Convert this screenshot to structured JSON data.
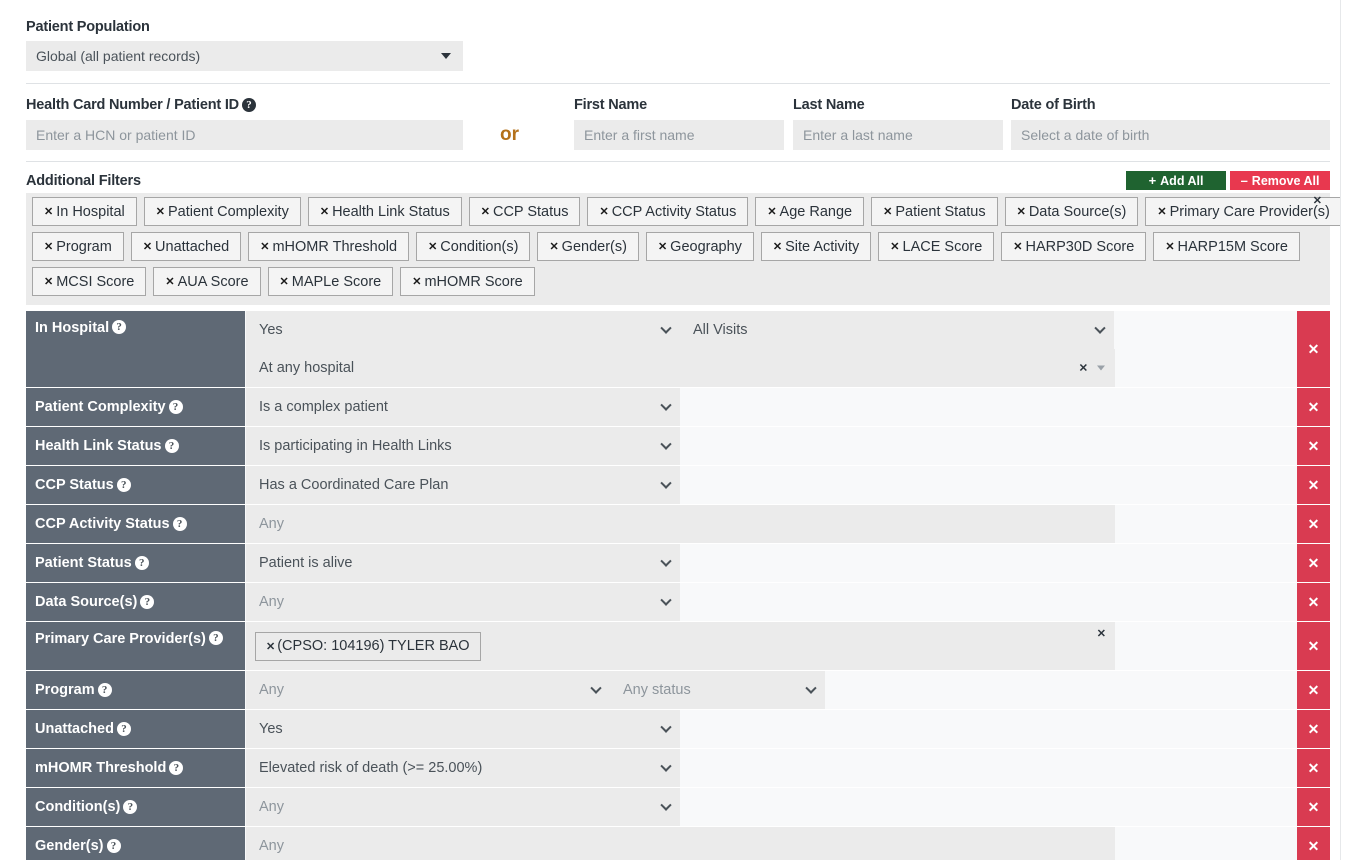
{
  "population": {
    "label": "Patient Population",
    "value": "Global (all patient records)"
  },
  "identity": {
    "hcn_label": "Health Card Number / Patient ID",
    "hcn_placeholder": "Enter a HCN or patient ID",
    "or_text": "or",
    "first_name_label": "First Name",
    "first_name_placeholder": "Enter a first name",
    "last_name_label": "Last Name",
    "last_name_placeholder": "Enter a last name",
    "dob_label": "Date of Birth",
    "dob_placeholder": "Select a date of birth"
  },
  "additional_filters": {
    "label": "Additional Filters",
    "add_all_label": "Add All",
    "remove_all_label": "Remove All",
    "add_all_sign": "+",
    "remove_all_sign": "–",
    "close_glyph": "✕",
    "tag_rows": [
      [
        "In Hospital",
        "Patient Complexity",
        "Health Link Status",
        "CCP Status",
        "CCP Activity Status",
        "Age Range",
        "Patient Status",
        "Data Source(s)",
        "Primary Care Provider(s)"
      ],
      [
        "Program",
        "Unattached",
        "mHOMR Threshold",
        "Condition(s)",
        "Gender(s)",
        "Geography",
        "Site Activity",
        "LACE Score",
        "HARP30D Score",
        "HARP15M Score"
      ],
      [
        "MCSI Score",
        "AUA Score",
        "MAPLe Score",
        "mHOMR Score"
      ]
    ]
  },
  "filter_rows": [
    {
      "name": "In Hospital",
      "primary": "Yes",
      "secondary": "All Visits",
      "extra_line": "At any hospital",
      "type": "double-with-token"
    },
    {
      "name": "Patient Complexity",
      "primary": "Is a complex patient",
      "type": "select"
    },
    {
      "name": "Health Link Status",
      "primary": "Is participating in Health Links",
      "type": "select"
    },
    {
      "name": "CCP Status",
      "primary": "Has a Coordinated Care Plan",
      "type": "select"
    },
    {
      "name": "CCP Activity Status",
      "primary": "Any",
      "type": "plain-wide"
    },
    {
      "name": "Patient Status",
      "primary": "Patient is alive",
      "type": "select"
    },
    {
      "name": "Data Source(s)",
      "primary": "Any",
      "type": "select-any"
    },
    {
      "name": "Primary Care Provider(s)",
      "token": "(CPSO: 104196) TYLER BAO",
      "type": "token-area"
    },
    {
      "name": "Program",
      "primary": "Any",
      "secondary": "Any status",
      "type": "program"
    },
    {
      "name": "Unattached",
      "primary": "Yes",
      "type": "select"
    },
    {
      "name": "mHOMR Threshold",
      "primary": "Elevated risk of death (>= 25.00%)",
      "type": "select"
    },
    {
      "name": "Condition(s)",
      "primary": "Any",
      "type": "select-any"
    },
    {
      "name": "Gender(s)",
      "primary": "Any",
      "type": "plain-wide"
    }
  ],
  "icons": {
    "help": "?",
    "delete": "✕",
    "tag_remove": "✕"
  },
  "colors": {
    "row_label_bg": "#5f6975",
    "delete_red": "#d93b51",
    "add_green": "#1f6330",
    "remove_red": "#e8384f",
    "or_orange": "#b4711a",
    "field_grey": "#ebebeb"
  }
}
